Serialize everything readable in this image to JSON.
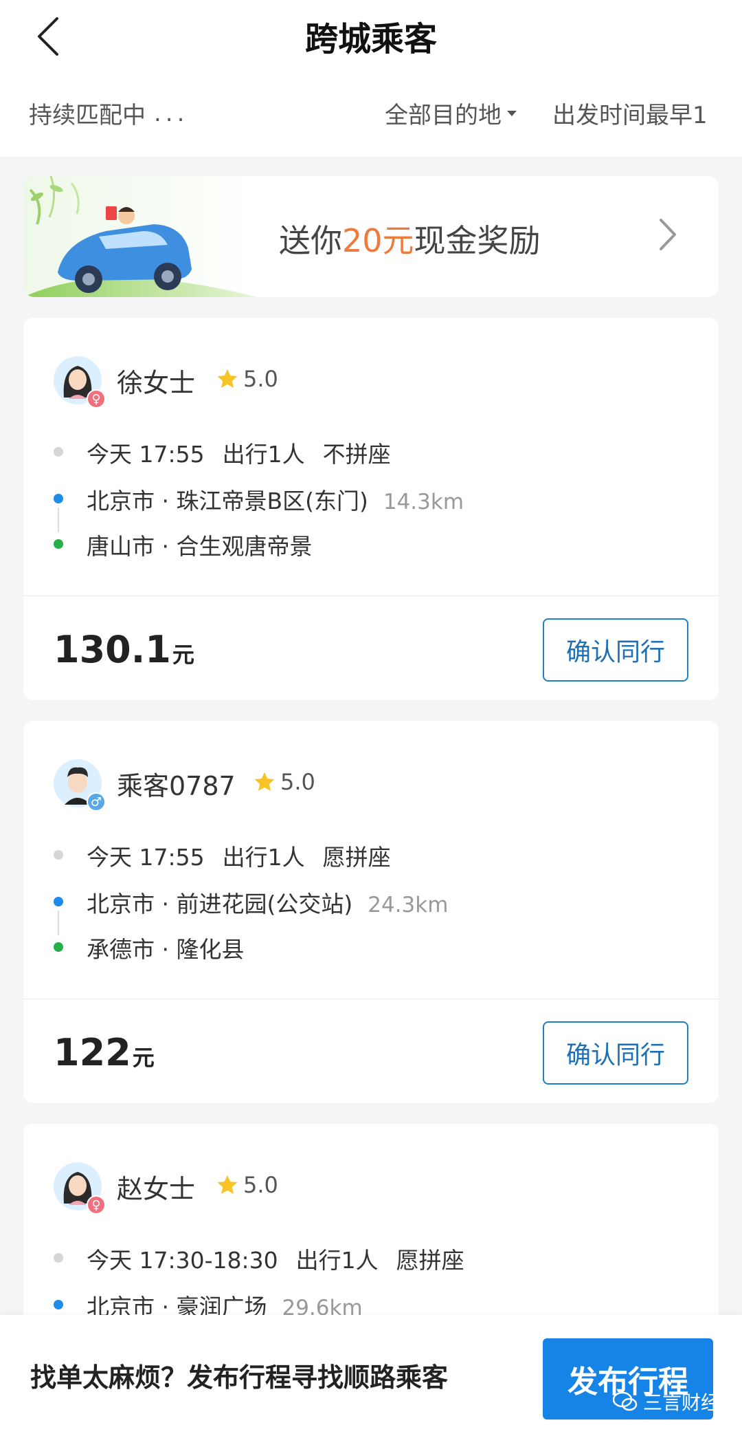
{
  "header": {
    "title": "跨城乘客"
  },
  "filters": {
    "status": "持续匹配中",
    "status_dots": "...",
    "destination": "全部目的地",
    "time": "出发时间最早1"
  },
  "promo": {
    "text_before": "送你",
    "amount": "20元",
    "text_after": "现金奖励",
    "accent_color": "#f07a3c"
  },
  "passengers": [
    {
      "name": "徐女士",
      "gender": "female",
      "rating": "5.0",
      "time": "今天 17:55",
      "count": "出行1人",
      "seat": "不拼座",
      "origin": "北京市 · 珠江帝景B区(东门)",
      "distance": "14.3km",
      "destination": "唐山市 · 合生观唐帝景",
      "price": "130.1",
      "unit": "元",
      "action": "确认同行"
    },
    {
      "name": "乘客0787",
      "gender": "male",
      "rating": "5.0",
      "time": "今天 17:55",
      "count": "出行1人",
      "seat": "愿拼座",
      "origin": "北京市 · 前进花园(公交站)",
      "distance": "24.3km",
      "destination": "承德市 · 隆化县",
      "price": "122",
      "unit": "元",
      "action": "确认同行"
    },
    {
      "name": "赵女士",
      "gender": "female",
      "rating": "5.0",
      "time": "今天 17:30-18:30",
      "count": "出行1人",
      "seat": "愿拼座",
      "origin": "北京市 · 豪润广场",
      "distance": "29.6km"
    }
  ],
  "bottom": {
    "hint": "找单太麻烦？发布行程寻找顺路乘客",
    "publish": "发布行程"
  },
  "watermark": "三言财经",
  "colors": {
    "primary": "#1684e6",
    "origin_dot": "#1e8ce8",
    "destination_dot": "#25b04a",
    "female_badge": "#f0707e",
    "male_badge": "#5aa7e6"
  }
}
